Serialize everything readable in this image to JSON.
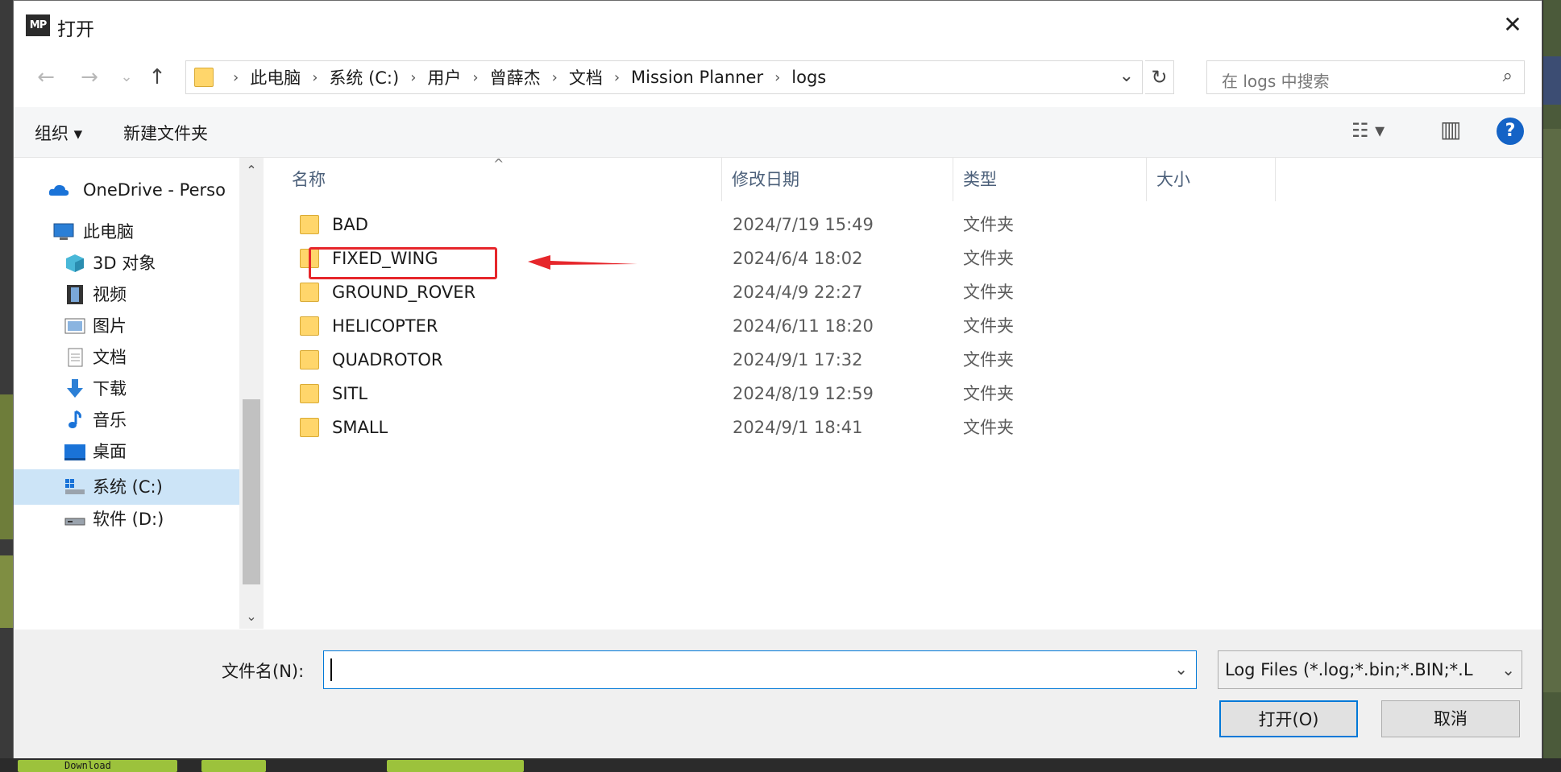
{
  "window": {
    "title": "打开",
    "app_icon_text": "MP",
    "close_glyph": "✕"
  },
  "nav": {
    "back": "←",
    "forward": "→",
    "recent": "⌄",
    "up": "↑"
  },
  "breadcrumb": [
    "此电脑",
    "系统 (C:)",
    "用户",
    "曾薛杰",
    "文档",
    "Mission Planner",
    "logs"
  ],
  "breadcrumb_separator": "›",
  "refresh_glyph": "↻",
  "search": {
    "placeholder": "在 logs 中搜索",
    "icon": "⌕"
  },
  "toolbar": {
    "organize": "组织 ▾",
    "new_folder": "新建文件夹",
    "view_glyph": "☷ ▾",
    "pane_glyph": "▥",
    "help": "?"
  },
  "sidebar": {
    "scroll_up": "⌃",
    "scroll_down": "⌄",
    "items": [
      {
        "label": "OneDrive - Perso",
        "icon": "cloud-icon",
        "selected": false
      },
      {
        "label": "此电脑",
        "icon": "computer-icon",
        "selected": false
      },
      {
        "label": "3D 对象",
        "icon": "cube-icon",
        "selected": false
      },
      {
        "label": "视频",
        "icon": "film-icon",
        "selected": false
      },
      {
        "label": "图片",
        "icon": "picture-icon",
        "selected": false
      },
      {
        "label": "文档",
        "icon": "document-icon",
        "selected": false
      },
      {
        "label": "下载",
        "icon": "download-arrow-icon",
        "selected": false
      },
      {
        "label": "音乐",
        "icon": "music-note-icon",
        "selected": false
      },
      {
        "label": "桌面",
        "icon": "desktop-icon",
        "selected": false
      },
      {
        "label": "系统 (C:)",
        "icon": "system-drive-icon",
        "selected": true
      },
      {
        "label": "软件 (D:)",
        "icon": "drive-icon",
        "selected": false
      }
    ]
  },
  "file_list": {
    "columns": [
      "名称",
      "修改日期",
      "类型",
      "大小"
    ],
    "sort_glyph": "^",
    "rows": [
      {
        "name": "BAD",
        "modified": "2024/7/19 15:49",
        "type": "文件夹"
      },
      {
        "name": "FIXED_WING",
        "modified": "2024/6/4 18:02",
        "type": "文件夹"
      },
      {
        "name": "GROUND_ROVER",
        "modified": "2024/4/9 22:27",
        "type": "文件夹"
      },
      {
        "name": "HELICOPTER",
        "modified": "2024/6/11 18:20",
        "type": "文件夹"
      },
      {
        "name": "QUADROTOR",
        "modified": "2024/9/1 17:32",
        "type": "文件夹"
      },
      {
        "name": "SITL",
        "modified": "2024/8/19 12:59",
        "type": "文件夹"
      },
      {
        "name": "SMALL",
        "modified": "2024/9/1 18:41",
        "type": "文件夹"
      }
    ]
  },
  "annotation": {
    "highlight_color": "#e6262b",
    "arrow_color": "#e6262b"
  },
  "bottom": {
    "filename_label": "文件名(N):",
    "filename_value": "",
    "filter_value": "Log Files (*.log;*.bin;*.BIN;*.L",
    "open_button": "打开(O)",
    "cancel_button": "取消",
    "dropdown_glyph": "⌄"
  },
  "background": {
    "download_button": "Download"
  }
}
